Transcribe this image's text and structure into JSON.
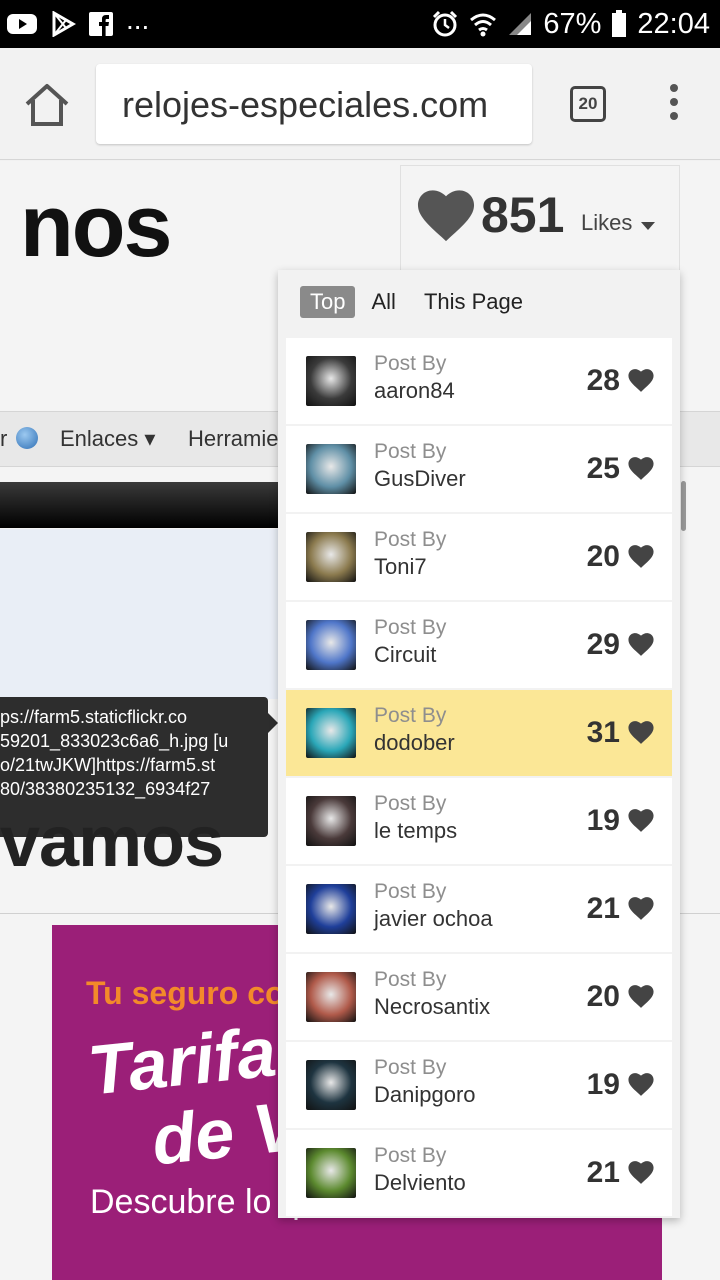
{
  "status_bar": {
    "battery": "67%",
    "time": "22:04",
    "overflow": "...",
    "icons": [
      "youtube-icon",
      "play-store-icon",
      "facebook-icon",
      "alarm-icon",
      "wifi-icon",
      "signal-icon",
      "battery-icon"
    ]
  },
  "browser": {
    "url": "relojes-especiales.com",
    "tab_count": "20"
  },
  "page": {
    "heading_partial": "nos",
    "nav_fragment": "r",
    "nav_enlaces": "Enlaces",
    "nav_herramientas": "Herramie",
    "tooltip_lines": [
      "ps://farm5.staticflickr.co",
      "59201_833023c6a6_h.jpg [u",
      "o/21twJKW]https://farm5.st",
      "80/38380235132_6934f27"
    ],
    "heading_vamos": "vamos",
    "ad": {
      "tagline": "Tu seguro co",
      "title_line1": "Tarifa",
      "title_line2": "de V",
      "subtitle": "Descubre lo q"
    }
  },
  "likes": {
    "count": "851",
    "label": "Likes",
    "filters": {
      "top": "Top",
      "all": "All",
      "this_page": "This Page",
      "selected": "Top"
    },
    "post_by_label": "Post By",
    "items": [
      {
        "author": "aaron84",
        "count": "28",
        "thumb": "#3b3b3b"
      },
      {
        "author": "GusDiver",
        "count": "25",
        "thumb": "#5f8fa6"
      },
      {
        "author": "Toni7",
        "count": "20",
        "thumb": "#8b7a4e"
      },
      {
        "author": "Circuit",
        "count": "29",
        "thumb": "#4f76c9"
      },
      {
        "author": "dodober",
        "count": "31",
        "thumb": "#2aa7b8",
        "highlighted": true
      },
      {
        "author": "le temps",
        "count": "19",
        "thumb": "#4a3a3a"
      },
      {
        "author": "javier ochoa",
        "count": "21",
        "thumb": "#1f3f9a"
      },
      {
        "author": "Necrosantix",
        "count": "20",
        "thumb": "#b05a4a"
      },
      {
        "author": "Danipgoro",
        "count": "19",
        "thumb": "#1e3440"
      },
      {
        "author": "Delviento",
        "count": "21",
        "thumb": "#5c8a2f"
      }
    ]
  }
}
